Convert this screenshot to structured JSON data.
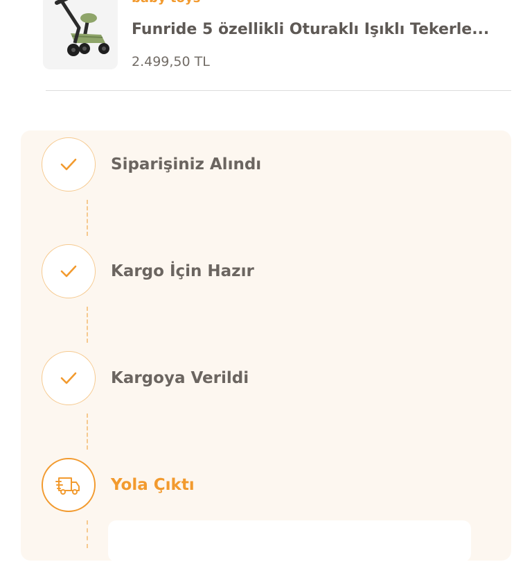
{
  "product": {
    "brand": "baby toys",
    "title": "Funride 5 özellikli Oturaklı Işıklı  Tekerle...",
    "price": "2.499,50 TL",
    "image": "kick-scooter-with-seat"
  },
  "tracking": {
    "steps": [
      {
        "label": "Siparişiniz Alındı",
        "icon": "check-icon",
        "state": "done"
      },
      {
        "label": "Kargo İçin Hazır",
        "icon": "check-icon",
        "state": "done"
      },
      {
        "label": "Kargoya Verildi",
        "icon": "check-icon",
        "state": "done"
      },
      {
        "label": "Yola Çıktı",
        "icon": "delivery-truck-icon",
        "state": "current"
      }
    ]
  },
  "colors": {
    "accent": "#f29a2e",
    "accent_light": "#f6c98e",
    "panel_bg": "#fdf7f0",
    "text": "#6b6560"
  }
}
